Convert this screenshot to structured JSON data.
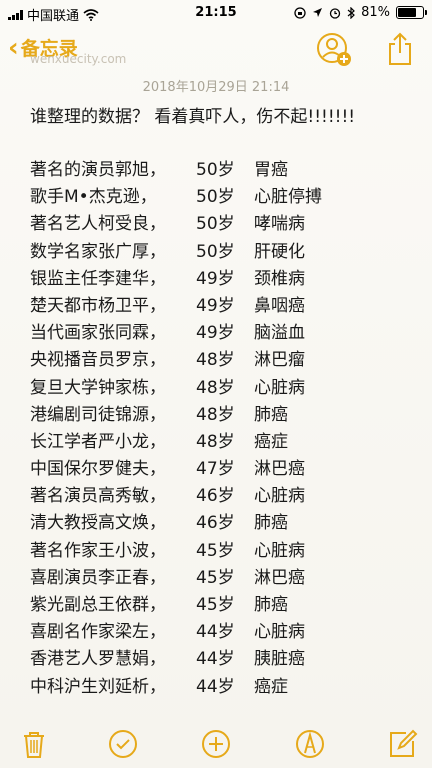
{
  "status_bar": {
    "carrier": "中国联通",
    "time": "21:15",
    "battery_text": "81%",
    "battery_level": 0.81
  },
  "nav": {
    "back_label": "备忘录",
    "watermark_text": "wenxuecity.com"
  },
  "note": {
    "date": "2018年10月29日 21:14",
    "headline": "谁整理的数据？ 看着真吓人，伤不起!!!!!!!",
    "entries": [
      {
        "name": "著名的演员郭旭，",
        "age": "50岁",
        "cause": "胃癌"
      },
      {
        "name": "歌手M•杰克逊，",
        "age": "50岁",
        "cause": "心脏停搏"
      },
      {
        "name": "著名艺人柯受良，",
        "age": "50岁",
        "cause": "哮喘病"
      },
      {
        "name": "数学名家张广厚，",
        "age": "50岁",
        "cause": "肝硬化"
      },
      {
        "name": "银监主任李建华，",
        "age": "49岁",
        "cause": "颈椎病"
      },
      {
        "name": "楚天都市杨卫平，",
        "age": "49岁",
        "cause": "鼻咽癌"
      },
      {
        "name": "当代画家张同霖，",
        "age": "49岁",
        "cause": "脑溢血"
      },
      {
        "name": "央视播音员罗京，",
        "age": "48岁",
        "cause": "淋巴瘤"
      },
      {
        "name": "复旦大学钟家栋，",
        "age": "48岁",
        "cause": "心脏病"
      },
      {
        "name": "港编剧司徒锦源，",
        "age": "48岁",
        "cause": "肺癌"
      },
      {
        "name": "长江学者严小龙，",
        "age": "48岁",
        "cause": "癌症"
      },
      {
        "name": "中国保尔罗健夫，",
        "age": "47岁",
        "cause": "淋巴癌"
      },
      {
        "name": "著名演员高秀敏，",
        "age": "46岁",
        "cause": "心脏病"
      },
      {
        "name": "清大教授高文焕，",
        "age": "46岁",
        "cause": "肺癌"
      },
      {
        "name": "著名作家王小波，",
        "age": "45岁",
        "cause": "心脏病"
      },
      {
        "name": "喜剧演员李正春，",
        "age": "45岁",
        "cause": "淋巴癌"
      },
      {
        "name": "紫光副总王依群，",
        "age": "45岁",
        "cause": "肺癌"
      },
      {
        "name": "喜剧名作家梁左，",
        "age": "44岁",
        "cause": "心脏病"
      },
      {
        "name": "香港艺人罗慧娟，",
        "age": "44岁",
        "cause": "胰脏癌"
      },
      {
        "name": "中科沪生刘延析，",
        "age": "44岁",
        "cause": "癌症"
      }
    ]
  },
  "colors": {
    "accent": "#e6a91a",
    "text": "#1a1a1a",
    "date_text": "#a9a496",
    "background": "#f8f6f0"
  },
  "icons": {
    "back": "chevron-left-icon",
    "add_person": "add-person-icon",
    "share": "share-icon",
    "trash": "trash-icon",
    "checklist": "checkmark-circle-icon",
    "add": "plus-circle-icon",
    "markup": "pen-markup-icon",
    "compose": "compose-icon"
  }
}
